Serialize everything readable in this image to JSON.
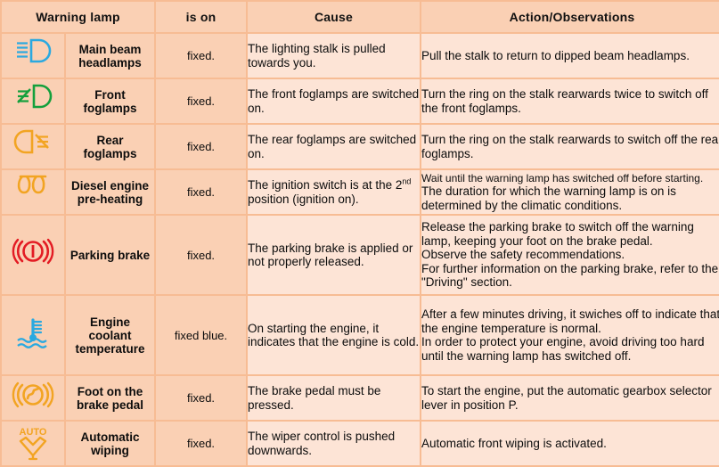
{
  "table": {
    "headers": {
      "lamp": "Warning lamp",
      "is_on": "is on",
      "cause": "Cause",
      "action": "Action/Observations"
    },
    "colors": {
      "header_bg": "#fad0b4",
      "cell_bg": "#fad0b4",
      "text_bg": "#fde4d6",
      "grid": "#f7bc94",
      "icon_blue": "#2aa9e0",
      "icon_green": "#14a03c",
      "icon_amber": "#f2a422",
      "icon_red": "#e31b23",
      "text": "#0c0c0c"
    },
    "rows": [
      {
        "icon": "main-beam-headlamps-icon",
        "icon_color": "#2aa9e0",
        "name": "Main beam headlamps",
        "name_lines": [
          "Main beam",
          "headlamps"
        ],
        "is_on": "fixed.",
        "cause": "The lighting stalk is pulled towards you.",
        "action_lines": [
          "Pull the stalk to return to dipped beam headlamps."
        ]
      },
      {
        "icon": "front-foglamps-icon",
        "icon_color": "#14a03c",
        "name": "Front foglamps",
        "name_lines": [
          "Front",
          "foglamps"
        ],
        "is_on": "fixed.",
        "cause": "The front foglamps are switched on.",
        "action_lines": [
          "Turn the ring on the stalk rearwards twice to switch off the front foglamps."
        ]
      },
      {
        "icon": "rear-foglamps-icon",
        "icon_color": "#f2a422",
        "name": "Rear foglamps",
        "name_lines": [
          "Rear",
          "foglamps"
        ],
        "is_on": "fixed.",
        "cause": "The rear foglamps are switched on.",
        "action_lines": [
          "Turn the ring on the stalk rearwards to switch off the rear foglamps."
        ]
      },
      {
        "icon": "diesel-preheating-icon",
        "icon_color": "#f2a422",
        "name": "Diesel engine pre-heating",
        "name_lines": [
          "Diesel engine",
          "pre-heating"
        ],
        "is_on": "fixed.",
        "cause_pre": "The ignition switch is at the 2",
        "cause_sup": "nd",
        "cause_post": " position (ignition on).",
        "cause": "The ignition switch is at the 2nd position (ignition on).",
        "action_lines": [
          "Wait until the warning lamp has switched off before starting.",
          "The duration for which the warning lamp is on is determined by the climatic conditions."
        ]
      },
      {
        "icon": "parking-brake-icon",
        "icon_color": "#e31b23",
        "name": "Parking brake",
        "name_lines": [
          "Parking brake"
        ],
        "is_on": "fixed.",
        "cause": "The parking brake is applied or not properly released.",
        "action_lines": [
          "Release the parking brake to switch off the warning lamp, keeping your foot on the brake pedal.",
          "Observe the safety recommendations.",
          "For further information on the parking brake, refer to the \"Driving\" section."
        ]
      },
      {
        "icon": "engine-coolant-temperature-icon",
        "icon_color": "#2aa9e0",
        "name": "Engine coolant temperature",
        "name_lines": [
          "Engine",
          "coolant",
          "temperature"
        ],
        "is_on": "fixed blue.",
        "cause": "On starting the engine, it indicates that the engine is cold.",
        "action_lines": [
          "After a few minutes driving, it swiches off to indicate that the engine temperature is normal.",
          "In order to protect your engine, avoid driving too hard until the warning lamp has switched off."
        ]
      },
      {
        "icon": "foot-on-brake-pedal-icon",
        "icon_color": "#f2a422",
        "name": "Foot on the brake pedal",
        "name_lines": [
          "Foot on the",
          "brake pedal"
        ],
        "is_on": "fixed.",
        "cause": "The brake pedal must be pressed.",
        "action_lines": [
          "To start the engine, put the automatic gearbox selector lever in position P."
        ]
      },
      {
        "icon": "automatic-wiping-icon",
        "icon_color": "#f2a422",
        "icon_label": "AUTO",
        "name": "Automatic wiping",
        "name_lines": [
          "Automatic",
          "wiping"
        ],
        "is_on": "fixed.",
        "cause": "The wiper control is pushed downwards.",
        "action_lines": [
          "Automatic front wiping is activated."
        ]
      }
    ]
  }
}
